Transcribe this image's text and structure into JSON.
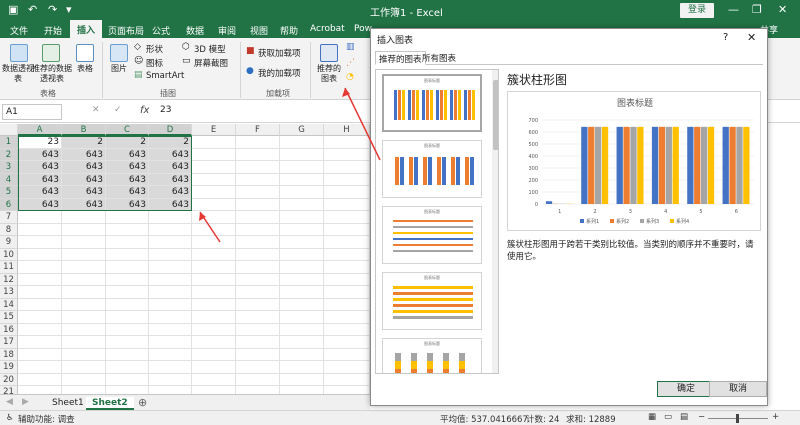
{
  "title": "工作簿1 - Excel",
  "login": "登录",
  "share": "共享",
  "tabs": [
    "文件",
    "开始",
    "插入",
    "页面布局",
    "公式",
    "数据",
    "审阅",
    "视图",
    "帮助",
    "Acrobat",
    "Pow"
  ],
  "active_tab": "插入",
  "ribbon": {
    "pivot": "数据透视表",
    "rec_pivot": "推荐的数据透视表",
    "table": "表格",
    "group_table": "表格",
    "picture": "图片",
    "shape": "形状",
    "icon": "图标",
    "model3d": "3D 模型",
    "screenshot": "屏幕截图",
    "smartart": "SmartArt",
    "group_illus": "插图",
    "get_addins": "获取加载项",
    "my_addins": "我的加载项",
    "group_addins": "加载项",
    "rec_chart": "推荐的图表"
  },
  "formula": {
    "name_box": "A1",
    "fx": "fx",
    "value": "23"
  },
  "columns": [
    "A",
    "B",
    "C",
    "D",
    "E",
    "F",
    "G",
    "H"
  ],
  "rows": [
    "1",
    "2",
    "3",
    "4",
    "5",
    "6",
    "7",
    "8",
    "9",
    "10",
    "11",
    "12",
    "13",
    "14",
    "15",
    "16",
    "17",
    "18",
    "19",
    "20",
    "21"
  ],
  "cells": [
    [
      "23",
      "2",
      "2",
      "2"
    ],
    [
      "643",
      "643",
      "643",
      "643"
    ],
    [
      "643",
      "643",
      "643",
      "643"
    ],
    [
      "643",
      "643",
      "643",
      "643"
    ],
    [
      "643",
      "643",
      "643",
      "643"
    ],
    [
      "643",
      "643",
      "643",
      "643"
    ]
  ],
  "sheets": [
    "Sheet1",
    "Sheet2"
  ],
  "active_sheet": "Sheet2",
  "status": {
    "accessibility": "辅助功能: 调查",
    "avg": "平均值: 537.0416667",
    "count": "计数: 24",
    "sum": "求和: 12889",
    "zoom_minus": "−",
    "zoom_plus": "+"
  },
  "dialog": {
    "title": "插入图表",
    "help": "?",
    "close": "✕",
    "tab_rec": "推荐的图表",
    "tab_all": "所有图表",
    "thumb_title": "图表标题",
    "chart_name": "簇状柱形图",
    "description": "簇状柱形图用于跨若干类别比较值。当类别的顺序并不重要时，请使用它。",
    "ok": "确定",
    "cancel": "取消"
  },
  "chart_data": {
    "type": "bar",
    "title": "图表标题",
    "categories": [
      "1",
      "2",
      "3",
      "4",
      "5",
      "6"
    ],
    "series": [
      {
        "name": "系列1",
        "values": [
          23,
          643,
          643,
          643,
          643,
          643
        ],
        "color": "#4472c4"
      },
      {
        "name": "系列2",
        "values": [
          2,
          643,
          643,
          643,
          643,
          643
        ],
        "color": "#ed7d31"
      },
      {
        "name": "系列3",
        "values": [
          2,
          643,
          643,
          643,
          643,
          643
        ],
        "color": "#a5a5a5"
      },
      {
        "name": "系列4",
        "values": [
          2,
          643,
          643,
          643,
          643,
          643
        ],
        "color": "#ffc000"
      }
    ],
    "yticks": [
      "0",
      "100",
      "200",
      "300",
      "400",
      "500",
      "600",
      "700"
    ],
    "ylim": [
      0,
      700
    ],
    "legend": "bottom",
    "grid": true
  }
}
